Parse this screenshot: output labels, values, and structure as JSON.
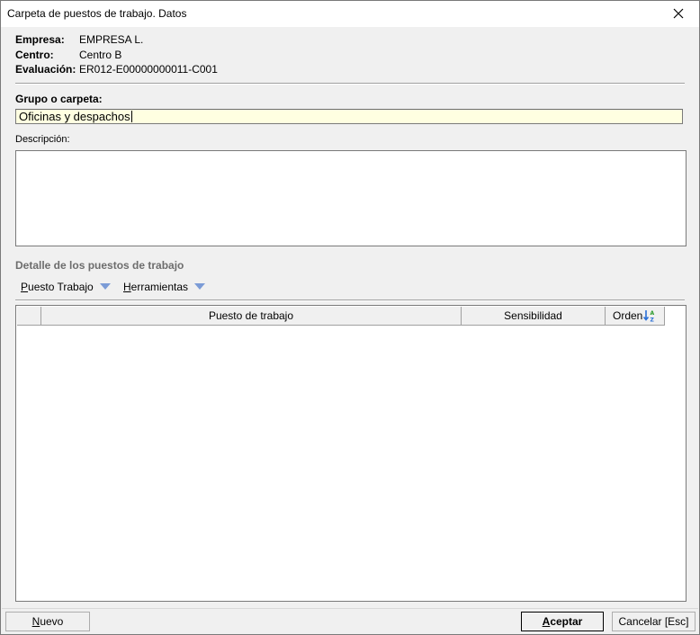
{
  "window": {
    "title": "Carpeta de puestos de trabajo. Datos"
  },
  "info": {
    "empresa_label": "Empresa:",
    "empresa_value": "EMPRESA L.",
    "centro_label": "Centro:",
    "centro_value": "Centro B",
    "evaluacion_label": "Evaluación:",
    "evaluacion_value": "ER012-E00000000011-C001"
  },
  "form": {
    "grupo_label": "Grupo o carpeta:",
    "grupo_value": "Oficinas y despachos",
    "descripcion_label": "Descripción:",
    "descripcion_value": ""
  },
  "detalle": {
    "title": "Detalle de los puestos de trabajo",
    "menu": [
      {
        "first": "P",
        "rest": "uesto Trabajo"
      },
      {
        "first": "H",
        "rest": "erramientas"
      }
    ],
    "columns": [
      "Puesto de trabajo",
      "Sensibilidad",
      "Orden"
    ],
    "rows": []
  },
  "buttons": {
    "nuevo_first": "N",
    "nuevo_rest": "uevo",
    "aceptar_first": "A",
    "aceptar_rest": "ceptar",
    "cancelar": "Cancelar [Esc]"
  },
  "colors": {
    "input_highlight": "#ffffe1",
    "menu_arrow": "#7b9bd6",
    "section_title": "#6d6d6d"
  },
  "icons": {
    "close": "close-icon",
    "menu_arrow": "triangle-down-icon",
    "sort": "sort-az-icon"
  }
}
